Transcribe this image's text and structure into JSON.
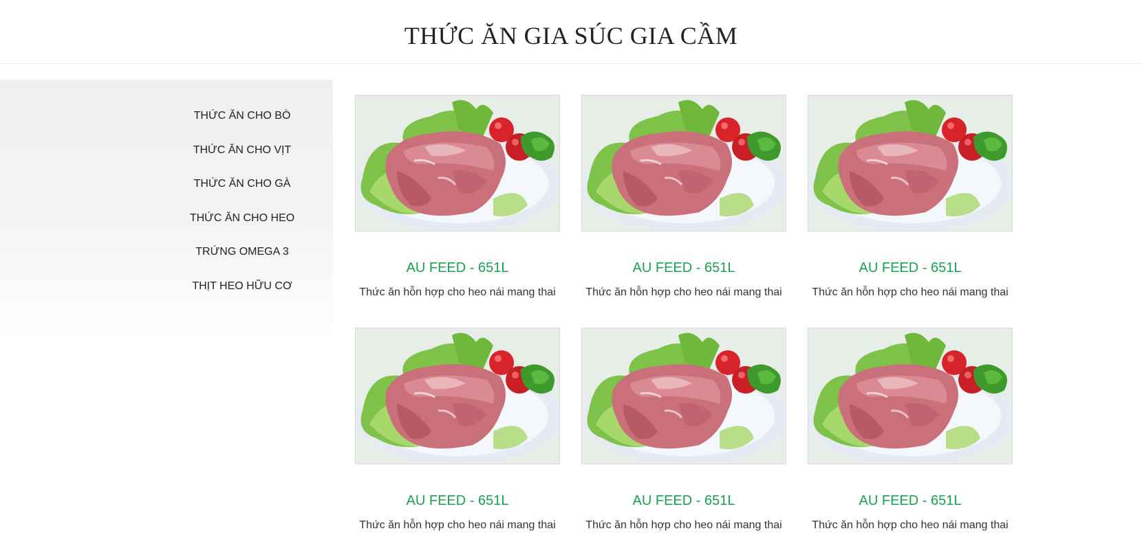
{
  "header": {
    "title": "THỨC ĂN GIA SÚC GIA CẦM"
  },
  "sidebar": {
    "items": [
      {
        "label": "THỨC ĂN CHO BÒ"
      },
      {
        "label": "THỨC ĂN CHO VỊT"
      },
      {
        "label": "THỨC ĂN CHO GÀ"
      },
      {
        "label": "THỨC ĂN CHO HEO"
      },
      {
        "label": "TRỨNG OMEGA 3"
      },
      {
        "label": "THỊT HEO HỮU CƠ"
      }
    ]
  },
  "products": [
    {
      "name": "AU FEED - 651L",
      "description": "Thức ăn hỗn hợp cho heo nái mang thai",
      "image": "raw-pork-on-plate"
    },
    {
      "name": "AU FEED - 651L",
      "description": "Thức ăn hỗn hợp cho heo nái mang thai",
      "image": "raw-pork-on-plate"
    },
    {
      "name": "AU FEED - 651L",
      "description": "Thức ăn hỗn hợp cho heo nái mang thai",
      "image": "raw-pork-on-plate"
    },
    {
      "name": "AU FEED - 651L",
      "description": "Thức ăn hỗn hợp cho heo nái mang thai",
      "image": "raw-pork-on-plate"
    },
    {
      "name": "AU FEED - 651L",
      "description": "Thức ăn hỗn hợp cho heo nái mang thai",
      "image": "raw-pork-on-plate"
    },
    {
      "name": "AU FEED - 651L",
      "description": "Thức ăn hỗn hợp cho heo nái mang thai",
      "image": "raw-pork-on-plate"
    }
  ],
  "colors": {
    "accent_green": "#1aa152",
    "text_dark": "#222222",
    "sidebar_bg": "#efefef"
  }
}
